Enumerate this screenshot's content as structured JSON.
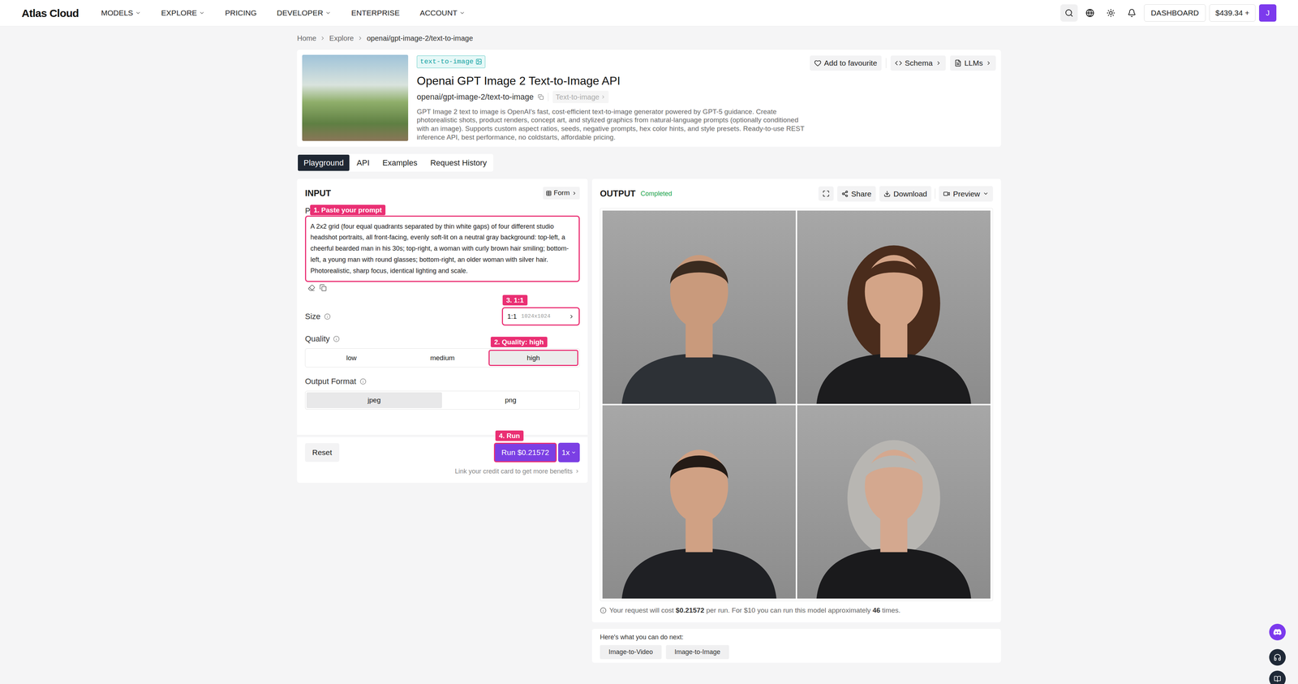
{
  "nav": {
    "logo": "Atlas Cloud",
    "items": [
      {
        "label": "MODELS",
        "has_menu": true
      },
      {
        "label": "EXPLORE",
        "has_menu": true
      },
      {
        "label": "PRICING",
        "has_menu": false
      },
      {
        "label": "DEVELOPER",
        "has_menu": true
      },
      {
        "label": "ENTERPRISE",
        "has_menu": false
      },
      {
        "label": "ACCOUNT",
        "has_menu": true
      }
    ],
    "dashboard": "DASHBOARD",
    "balance": "$439.34 +",
    "avatar": "J"
  },
  "breadcrumb": [
    "Home",
    "Explore",
    "openai/gpt-image-2/text-to-image"
  ],
  "model": {
    "badge": "text-to-image",
    "title": "Openai GPT Image 2 Text-to-Image API",
    "id": "openai/gpt-image-2/text-to-image",
    "category": "Text-to-image",
    "description": "GPT Image 2 text to image is OpenAI's fast, cost-efficient text-to-image generator powered by GPT-5 guidance. Create photorealistic shots, product renders, concept art, and stylized graphics from natural-language prompts (optionally conditioned with an image). Supports custom aspect ratios, seeds, negative prompts, hex color hints, and style presets. Ready-to-use REST inference API, best performance, no coldstarts, affordable pricing.",
    "favourite": "Add to favourite",
    "schema": "Schema",
    "llms": "LLMs"
  },
  "tabs": [
    {
      "label": "Playground",
      "selected": true
    },
    {
      "label": "API",
      "selected": false
    },
    {
      "label": "Examples",
      "selected": false
    },
    {
      "label": "Request History",
      "selected": false
    }
  ],
  "input": {
    "title": "INPUT",
    "form_button": "Form",
    "prompt_label": "P",
    "prompt_note": "1. Paste your prompt",
    "prompt": "A 2x2 grid (four equal quadrants separated by thin white gaps) of four different studio headshot portraits, all front-facing, evenly soft-lit on a neutral gray background: top-left, a cheerful bearded man in his 30s; top-right, a woman with curly brown hair smiling; bottom-left, a young man with round glasses; bottom-right, an older woman with silver hair. Photorealistic, sharp focus, identical lighting and scale.",
    "size": {
      "label": "Size",
      "note": "3. 1:1",
      "value": "1:1",
      "detail": "1024x1024"
    },
    "quality": {
      "label": "Quality",
      "note": "2. Quality: high",
      "options": [
        {
          "label": "low",
          "selected": false
        },
        {
          "label": "medium",
          "selected": false
        },
        {
          "label": "high",
          "selected": true
        }
      ]
    },
    "output_format": {
      "label": "Output Format",
      "options": [
        {
          "label": "jpeg",
          "selected": true
        },
        {
          "label": "png",
          "selected": false
        }
      ]
    },
    "reset": "Reset",
    "run_note": "4. Run",
    "run": "Run $0.21572",
    "multiplier": "1x",
    "hint": "Link your credit card to get more benefits"
  },
  "output": {
    "title": "OUTPUT",
    "status": "Completed",
    "share": "Share",
    "download": "Download",
    "preview": "Preview",
    "cost_note": [
      {
        "text": "Your request will cost ",
        "bold": false
      },
      {
        "text": "$0.21572",
        "bold": true
      },
      {
        "text": " per run. For $10 you can run this model approximately ",
        "bold": false
      },
      {
        "text": "46",
        "bold": true
      },
      {
        "text": " times.",
        "bold": false
      }
    ]
  },
  "next": {
    "title": "Here's what you can do next:",
    "actions": [
      "Image-to-Video",
      "Image-to-Image"
    ]
  }
}
